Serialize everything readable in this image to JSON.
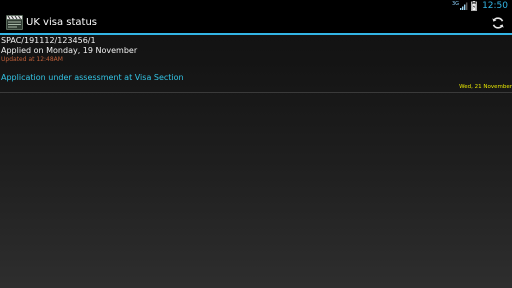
{
  "status_bar": {
    "network_label": "3G",
    "time": "12:50",
    "icons": [
      "signal-icon",
      "battery-icon"
    ]
  },
  "action_bar": {
    "title": "UK visa status",
    "app_icon": "clapperboard-icon",
    "refresh_icon": "refresh-icon"
  },
  "entry": {
    "reference": "SPAC/191112/123456/1",
    "applied": "Applied on Monday, 19 November",
    "updated": "Updated at 12:48AM",
    "status": "Application under assessment at Visa Section",
    "status_date": "Wed, 21 November"
  },
  "colors": {
    "accent": "#33b5e5",
    "updated_text": "#c0603a",
    "status_text": "#33c4e5",
    "date_text": "#e8e800"
  }
}
